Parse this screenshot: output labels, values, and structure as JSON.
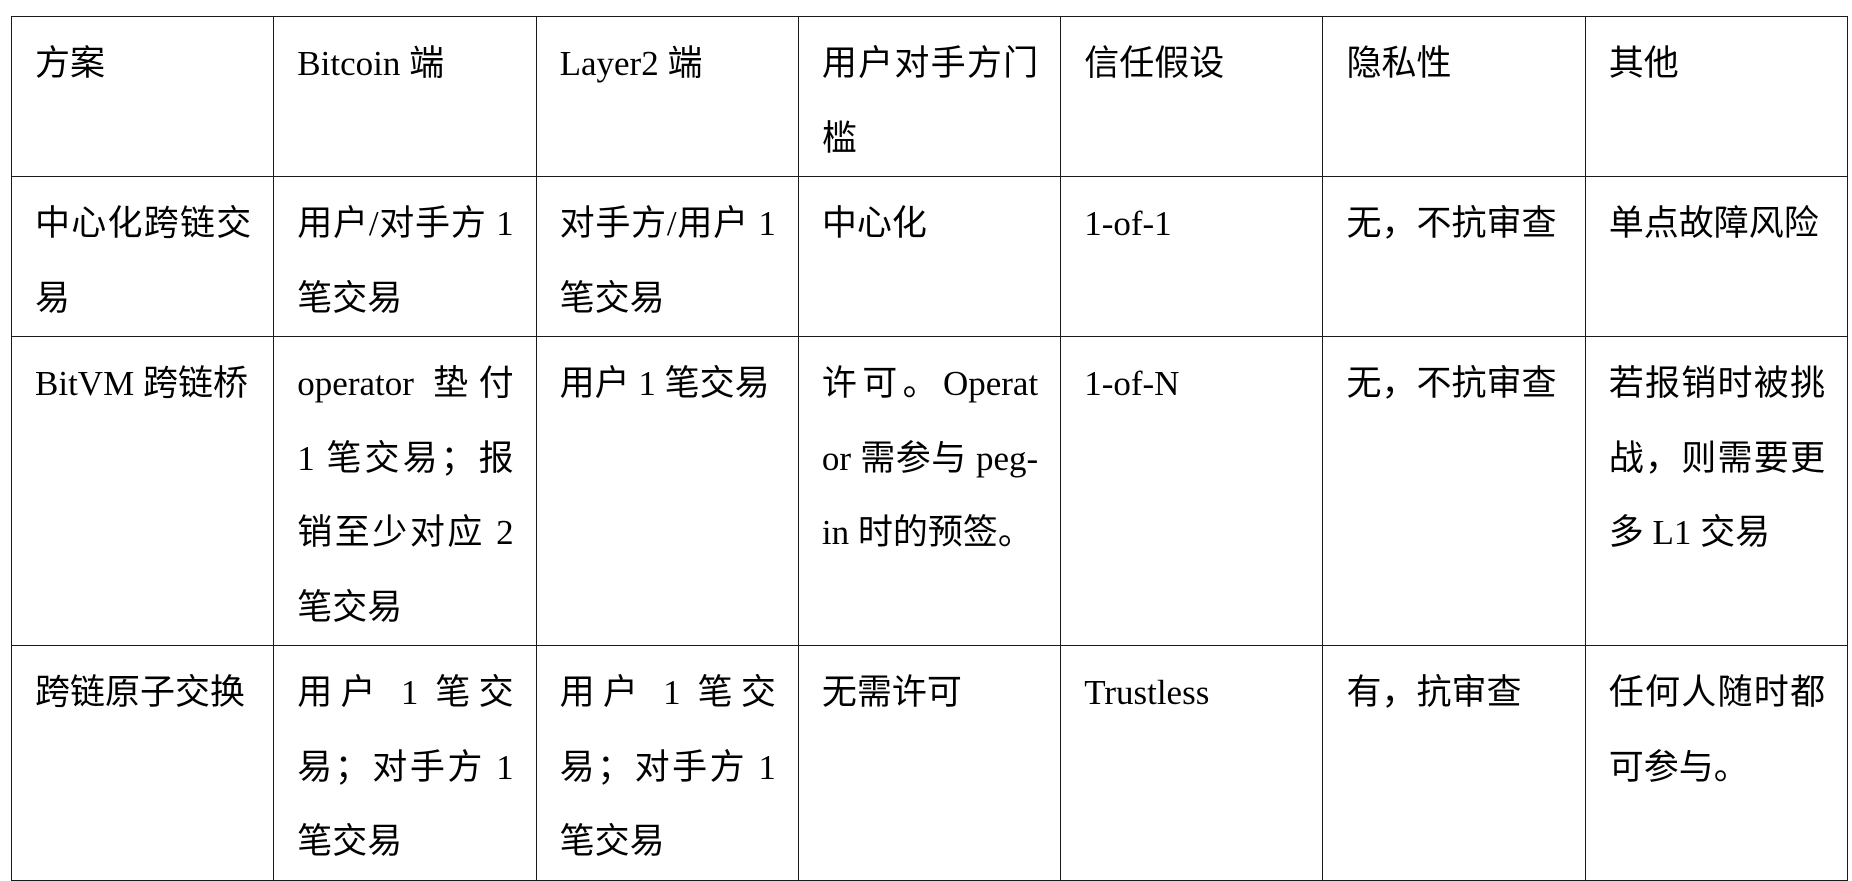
{
  "table": {
    "headers": [
      "方案",
      "Bitcoin 端",
      "Layer2 端",
      "用户对手方门槛",
      "信任假设",
      "隐私性",
      "其他"
    ],
    "rows": [
      {
        "scheme": "中心化跨链交易",
        "bitcoin_side": "用户/对手方 1 笔交易",
        "layer2_side": "对手方/用户 1 笔交易",
        "counterparty_threshold": "中心化",
        "trust_assumption": "1-of-1",
        "privacy": "无，不抗审查",
        "other": "单点故障风险"
      },
      {
        "scheme": "BitVM 跨链桥",
        "bitcoin_side": "operator 垫付 1 笔交易；报销至少对应 2 笔交易",
        "layer2_side": "用户 1 笔交易",
        "counterparty_threshold": "许可。Operator 需参与 peg-in 时的预签。",
        "trust_assumption": "1-of-N",
        "privacy": "无，不抗审查",
        "other": "若报销时被挑战，则需要更多 L1 交易"
      },
      {
        "scheme": "跨链原子交换",
        "bitcoin_side": "用户 1 笔交易；对手方 1 笔交易",
        "layer2_side": "用户 1 笔交易；对手方 1 笔交易",
        "counterparty_threshold": "无需许可",
        "trust_assumption": "Trustless",
        "privacy": "有，抗审查",
        "other": "任何人随时都可参与。"
      }
    ]
  }
}
